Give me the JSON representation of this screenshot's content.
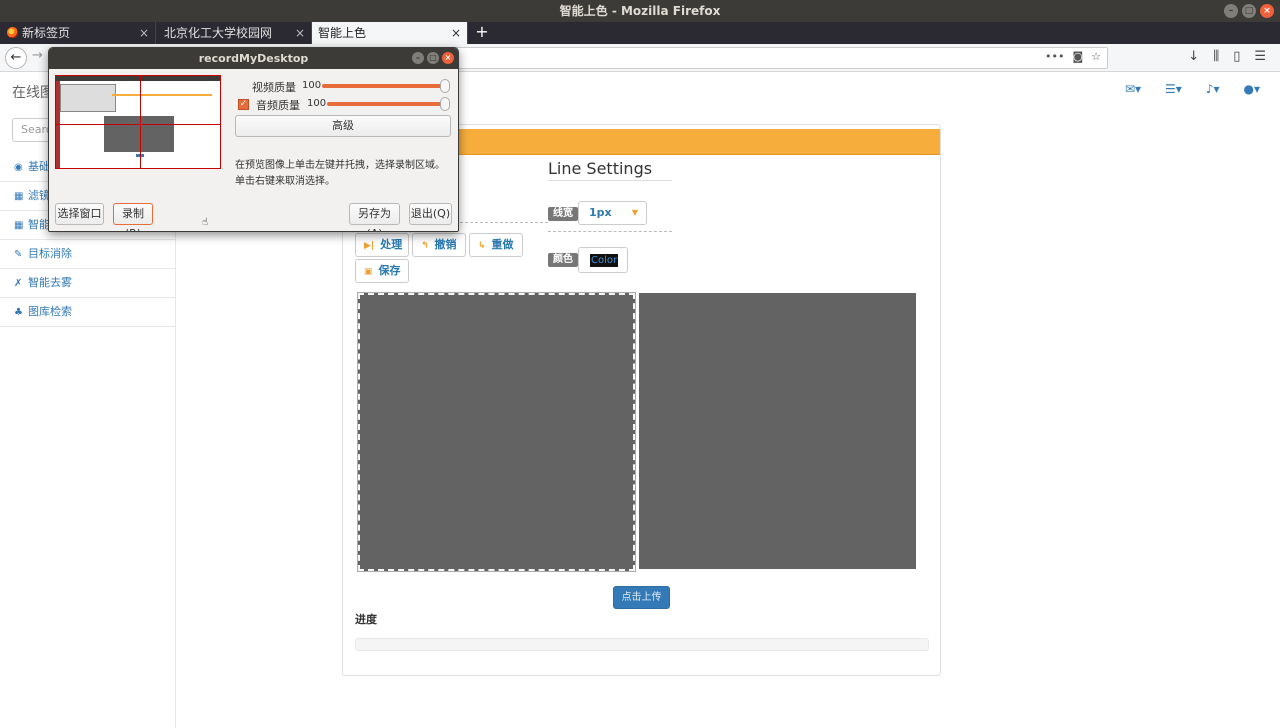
{
  "window": {
    "title": "智能上色 - Mozilla Firefox"
  },
  "tabs": [
    {
      "label": "新标签页"
    },
    {
      "label": "北京化工大学校园网"
    },
    {
      "label": "智能上色"
    }
  ],
  "sidebar": {
    "brand": "在线图",
    "search_placeholder": "Search",
    "items": [
      {
        "label": "基础",
        "icon": "dashboard-icon"
      },
      {
        "label": "滤镜",
        "icon": "table-icon"
      },
      {
        "label": "智能",
        "icon": "table-icon"
      },
      {
        "label": "目标消除",
        "icon": "edit-icon"
      },
      {
        "label": "智能去雾",
        "icon": "wrench-icon"
      },
      {
        "label": "图库检索",
        "icon": "sitemap-icon"
      }
    ]
  },
  "main": {
    "section_title": "Line Settings",
    "line_width_label": "线宽",
    "line_width_value": "1px",
    "color_label": "颜色",
    "color_button": "Color",
    "buttons": {
      "process": "处理",
      "undo": "撤销",
      "redo": "重做",
      "save": "保存"
    },
    "upload_button": "点击上传",
    "progress_label": "进度",
    "progress_fraction": 0
  },
  "dialog": {
    "title": "recordMyDesktop",
    "video_quality_label": "视频质量",
    "video_quality_value": "100",
    "audio_quality_label": "音频质量",
    "audio_quality_value": "100",
    "advanced_button": "高级",
    "hint_line1": "在预览图像上单击左键并托拽，选择录制区域。",
    "hint_line2": "单击右键来取消选择。",
    "select_window_button": "选择窗口",
    "record_button": "录制(R)",
    "save_as_button": "另存为(A)",
    "quit_button": "退出(Q)"
  },
  "colors": {
    "accent_orange": "#f7ad3c",
    "primary_blue": "#337ab7",
    "record_orange": "#e86b3a"
  }
}
